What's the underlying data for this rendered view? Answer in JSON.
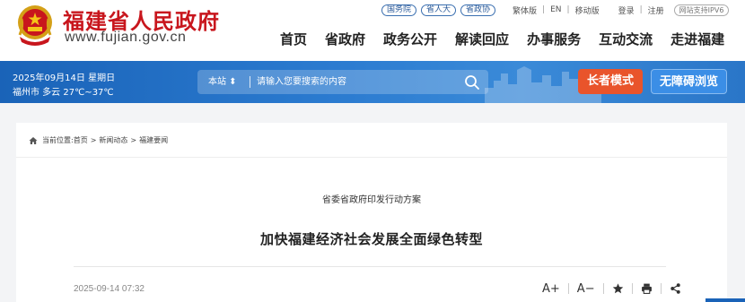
{
  "header": {
    "site_name": "福建省人民政府",
    "site_url": "www.fujian.gov.cn",
    "top_pills": [
      "国务院",
      "省人大",
      "省政协"
    ],
    "lang_links": [
      "繁体版",
      "EN",
      "移动版"
    ],
    "account_links": [
      "登录",
      "注册"
    ],
    "ipv6_badge": "网站支持IPV6",
    "nav": [
      "首页",
      "省政府",
      "政务公开",
      "解读回应",
      "办事服务",
      "互动交流",
      "走进福建"
    ]
  },
  "band": {
    "date": "2025年09月14日 星期日",
    "weather": "福州市 多云 27℃~37℃",
    "search_scope": "本站 ⬍",
    "search_placeholder": "请输入您要搜索的内容",
    "elder_mode_label": "长者模式",
    "accessible_label": "无障碍浏览"
  },
  "article": {
    "breadcrumb_prefix": "当前位置:",
    "breadcrumb": [
      "首页",
      "新闻动态",
      "福建要闻"
    ],
    "subtitle": "省委省政府印发行动方案",
    "title": "加快福建经济社会发展全面绿色转型",
    "publish_date": "2025-09-14 07:32",
    "tools": {
      "font_up": "A+",
      "font_down": "A−"
    }
  },
  "colors": {
    "brand_red": "#c8161d",
    "band_blue": "#1a63b8",
    "elder_orange": "#e9542b",
    "access_blue": "#3b8ee6"
  }
}
